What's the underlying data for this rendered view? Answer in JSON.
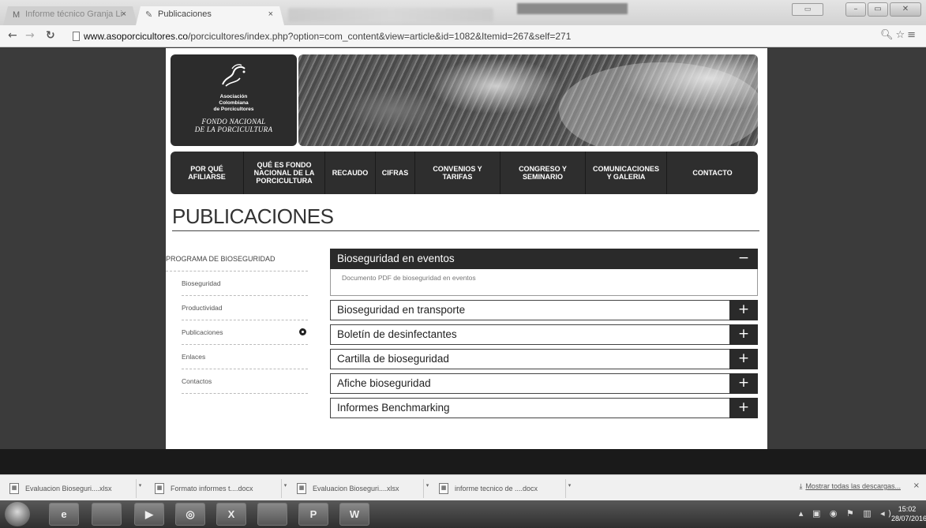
{
  "browser": {
    "tabs": [
      {
        "label": "Informe técnico Granja Li",
        "icon": "gmail-icon",
        "active": false
      },
      {
        "label": "Publicaciones",
        "icon": "site-logo-icon",
        "active": true
      }
    ],
    "close_glyph": "×",
    "url_host": "www.asoporcicultores.co",
    "url_path": "/porcicultores/index.php?option=com_content&view=article&id=1082&Itemid=267&self=271"
  },
  "site": {
    "logo_org": "Asociación\nColombiana\nde Porcicultores",
    "logo_fondo": "FONDO NACIONAL\nDE LA PORCICULTURA",
    "nav": [
      {
        "label": "POR QUÉ\nAFILIARSE"
      },
      {
        "label": "QUÉ ES FONDO\nNACIONAL DE LA\nPORCICULTURA"
      },
      {
        "label": "RECAUDO"
      },
      {
        "label": "CIFRAS"
      },
      {
        "label": "CONVENIOS Y\nTARIFAS"
      },
      {
        "label": "CONGRESO Y\nSEMINARIO"
      },
      {
        "label": "COMUNICACIONES\nY GALERIA"
      },
      {
        "label": "CONTACTO"
      }
    ],
    "page_title": "PUBLICACIONES",
    "sidebar": {
      "heading": "PROGRAMA DE BIOSEGURIDAD",
      "items": [
        {
          "label": "Bioseguridad"
        },
        {
          "label": "Productividad"
        },
        {
          "label": "Publicaciones",
          "current": true
        },
        {
          "label": "Enlaces"
        },
        {
          "label": "Contactos"
        }
      ]
    },
    "accordion": [
      {
        "label": "Bioseguridad en eventos",
        "toggle": "−",
        "open": true,
        "body": "Documento PDF de bioseguridad en eventos"
      },
      {
        "label": "Bioseguridad en transporte",
        "toggle": "+"
      },
      {
        "label": "Boletín de desinfectantes",
        "toggle": "+"
      },
      {
        "label": "Cartilla de bioseguridad",
        "toggle": "+"
      },
      {
        "label": "Afiche bioseguridad",
        "toggle": "+"
      },
      {
        "label": "Informes Benchmarking",
        "toggle": "+"
      }
    ]
  },
  "downloads": {
    "items": [
      {
        "label": "Evaluacion Bioseguri....xlsx"
      },
      {
        "label": "Formato informes t....docx"
      },
      {
        "label": "Evaluacion Bioseguri....xlsx"
      },
      {
        "label": "informe tecnico de ....docx"
      }
    ],
    "show_all": "Mostrar todas las descargas...",
    "close_glyph": "×"
  },
  "taskbar": {
    "time": "15:02",
    "date": "28/07/2016",
    "apps": [
      "ie-icon",
      "explorer-icon",
      "media-player-icon",
      "chrome-icon",
      "excel-icon",
      "gimp-icon",
      "publisher-icon",
      "word-icon"
    ],
    "app_letters": [
      "e",
      "",
      "▶",
      "◎",
      "X",
      "",
      "P",
      "W"
    ]
  }
}
